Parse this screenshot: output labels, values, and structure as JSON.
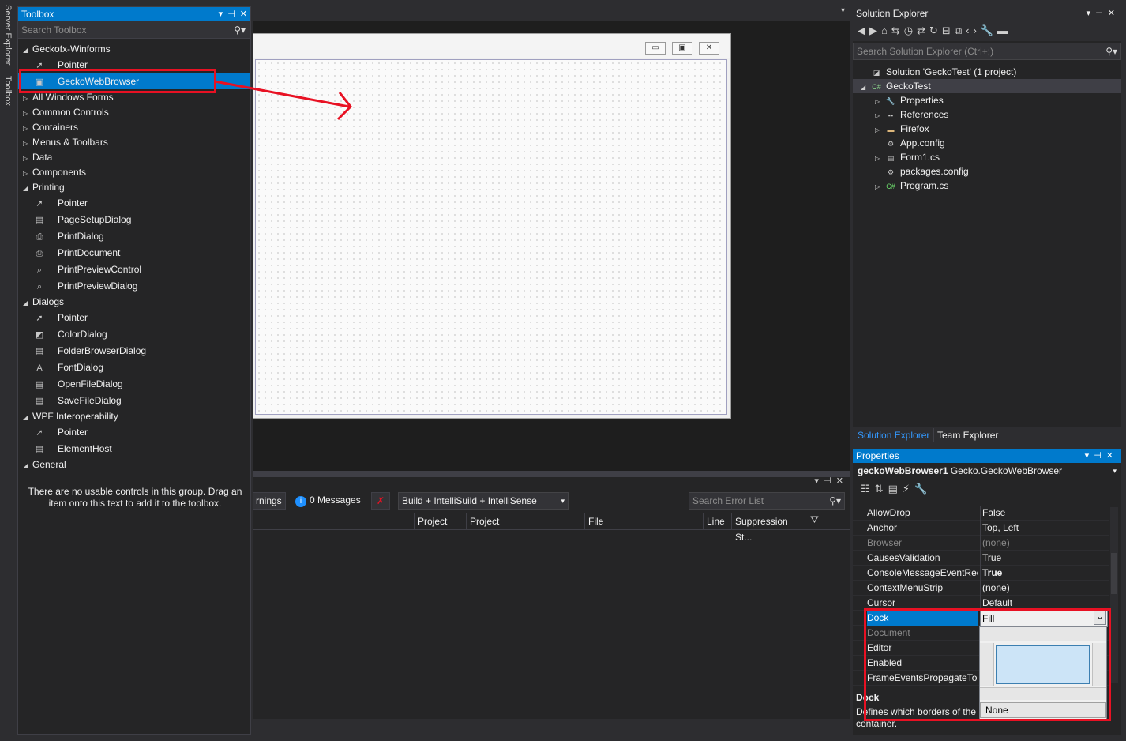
{
  "side_tabs": [
    "Server Explorer",
    "Toolbox"
  ],
  "toolbox": {
    "title": "Toolbox",
    "search_placeholder": "Search Toolbox",
    "empty_message": "There are no usable controls in this group. Drag an item onto this text to add it to the toolbox.",
    "rows": [
      {
        "kind": "cat",
        "label": "Geckofx-Winforms",
        "expanded": true
      },
      {
        "kind": "item",
        "label": "Pointer",
        "icon": "pointer-icon"
      },
      {
        "kind": "item",
        "label": "GeckoWebBrowser",
        "icon": "browser-control-icon",
        "selected": true
      },
      {
        "kind": "cat",
        "label": "All Windows Forms",
        "expanded": false
      },
      {
        "kind": "cat",
        "label": "Common Controls",
        "expanded": false
      },
      {
        "kind": "cat",
        "label": "Containers",
        "expanded": false
      },
      {
        "kind": "cat",
        "label": "Menus & Toolbars",
        "expanded": false
      },
      {
        "kind": "cat",
        "label": "Data",
        "expanded": false
      },
      {
        "kind": "cat",
        "label": "Components",
        "expanded": false
      },
      {
        "kind": "cat",
        "label": "Printing",
        "expanded": true
      },
      {
        "kind": "item",
        "label": "Pointer",
        "icon": "pointer-icon"
      },
      {
        "kind": "item",
        "label": "PageSetupDialog",
        "icon": "dialog-icon"
      },
      {
        "kind": "item",
        "label": "PrintDialog",
        "icon": "printer-icon"
      },
      {
        "kind": "item",
        "label": "PrintDocument",
        "icon": "printer-icon"
      },
      {
        "kind": "item",
        "label": "PrintPreviewControl",
        "icon": "preview-icon"
      },
      {
        "kind": "item",
        "label": "PrintPreviewDialog",
        "icon": "preview-icon"
      },
      {
        "kind": "cat",
        "label": "Dialogs",
        "expanded": true
      },
      {
        "kind": "item",
        "label": "Pointer",
        "icon": "pointer-icon"
      },
      {
        "kind": "item",
        "label": "ColorDialog",
        "icon": "color-dialog-icon"
      },
      {
        "kind": "item",
        "label": "FolderBrowserDialog",
        "icon": "dialog-icon"
      },
      {
        "kind": "item",
        "label": "FontDialog",
        "icon": "font-dialog-icon"
      },
      {
        "kind": "item",
        "label": "OpenFileDialog",
        "icon": "dialog-icon"
      },
      {
        "kind": "item",
        "label": "SaveFileDialog",
        "icon": "dialog-icon"
      },
      {
        "kind": "cat",
        "label": "WPF Interoperability",
        "expanded": true
      },
      {
        "kind": "item",
        "label": "Pointer",
        "icon": "pointer-icon"
      },
      {
        "kind": "item",
        "label": "ElementHost",
        "icon": "dialog-icon"
      },
      {
        "kind": "cat",
        "label": "General",
        "expanded": true
      }
    ]
  },
  "error_list": {
    "warnings_label": "rnings",
    "messages_label": "0 Messages",
    "build_filter": "Build + IntelliSuild + IntelliSense",
    "search_placeholder": "Search Error List",
    "columns": [
      "Project",
      "Project",
      "File",
      "Line",
      "Suppression St..."
    ]
  },
  "solution_explorer": {
    "title": "Solution Explorer",
    "search_placeholder": "Search Solution Explorer (Ctrl+;)",
    "rows": [
      {
        "label": "Solution 'GeckoTest' (1 project)",
        "indent": 0,
        "arrow": "",
        "icon": "solution-icon"
      },
      {
        "label": "GeckoTest",
        "indent": 0,
        "arrow": "▲",
        "icon": "csharp-project-icon",
        "selected": true
      },
      {
        "label": "Properties",
        "indent": 1,
        "arrow": "▶",
        "icon": "wrench-icon"
      },
      {
        "label": "References",
        "indent": 1,
        "arrow": "▶",
        "icon": "references-icon"
      },
      {
        "label": "Firefox",
        "indent": 1,
        "arrow": "▶",
        "icon": "folder-icon"
      },
      {
        "label": "App.config",
        "indent": 1,
        "arrow": "",
        "icon": "config-file-icon"
      },
      {
        "label": "Form1.cs",
        "indent": 1,
        "arrow": "▶",
        "icon": "form-icon"
      },
      {
        "label": "packages.config",
        "indent": 1,
        "arrow": "",
        "icon": "config-file-icon"
      },
      {
        "label": "Program.cs",
        "indent": 1,
        "arrow": "▶",
        "icon": "csharp-file-icon"
      }
    ],
    "tabs": [
      "Solution Explorer",
      "Team Explorer"
    ]
  },
  "properties": {
    "title": "Properties",
    "object_name": "geckoWebBrowser1",
    "object_type": "Gecko.GeckoWebBrowser",
    "rows": [
      {
        "name": "AllowDrop",
        "value": "False"
      },
      {
        "name": "Anchor",
        "value": "Top, Left"
      },
      {
        "name": "Browser",
        "value": "(none)",
        "disabled": true
      },
      {
        "name": "CausesValidation",
        "value": "True"
      },
      {
        "name": "ConsoleMessageEventReceivers",
        "value": "True",
        "bold": true
      },
      {
        "name": "ContextMenuStrip",
        "value": "(none)"
      },
      {
        "name": "Cursor",
        "value": "Default"
      },
      {
        "name": "Dock",
        "value": "Fill",
        "selected": true
      },
      {
        "name": "Document",
        "value": "",
        "disabled": true
      },
      {
        "name": "Editor",
        "value": ""
      },
      {
        "name": "Enabled",
        "value": ""
      },
      {
        "name": "FrameEventsPropagateToMainWindow",
        "value": ""
      }
    ],
    "desc_title": "Dock",
    "desc_text": "Defines which borders of the",
    "desc_text2": "container.",
    "dock_none_label": "None"
  },
  "colors": {
    "accent": "#007acc",
    "highlight_red": "#e81123"
  }
}
